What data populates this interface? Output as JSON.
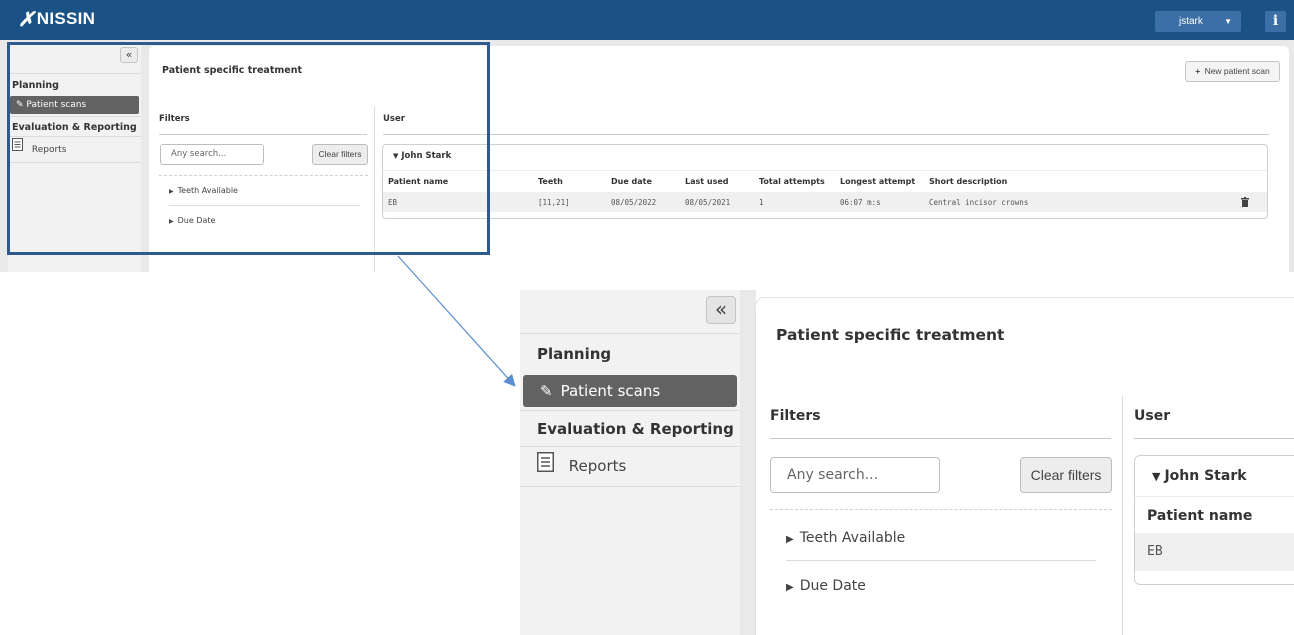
{
  "app": {
    "logo_text": "NISSIN",
    "user_menu_label": "jstark",
    "info_label": "i",
    "icons": [
      "pencil-icon",
      "document-icon",
      "trash-icon",
      "plus-icon",
      "double-chevron-left-icon",
      "caret-down-icon",
      "caret-right-icon"
    ]
  },
  "sidebar": {
    "collapse_label": "«",
    "planning_header": "Planning",
    "patient_scans_label": "Patient scans",
    "evaluation_header": "Evaluation & Reporting",
    "reports_label": "Reports"
  },
  "main": {
    "page_title": "Patient specific treatment",
    "new_scan_label": "New patient scan",
    "filters": {
      "header": "Filters",
      "search_placeholder": "Any search...",
      "clear_label": "Clear filters",
      "facets": [
        "Teeth Available",
        "Due Date"
      ]
    },
    "user_section": {
      "header": "User",
      "user_name": "John Stark",
      "columns": [
        "Patient name",
        "Teeth",
        "Due date",
        "Last used",
        "Total attempts",
        "Longest attempt",
        "Short description"
      ],
      "rows": [
        [
          "EB",
          "[11,21]",
          "08/05/2022",
          "08/05/2021",
          "1",
          "06:07 m:s",
          "Central incisor crowns"
        ]
      ]
    }
  },
  "colors": {
    "topbar": "#1a5285",
    "active_item": "#626262",
    "highlight_box": "#2e5a8e",
    "arrow": "#5b8fd0"
  }
}
